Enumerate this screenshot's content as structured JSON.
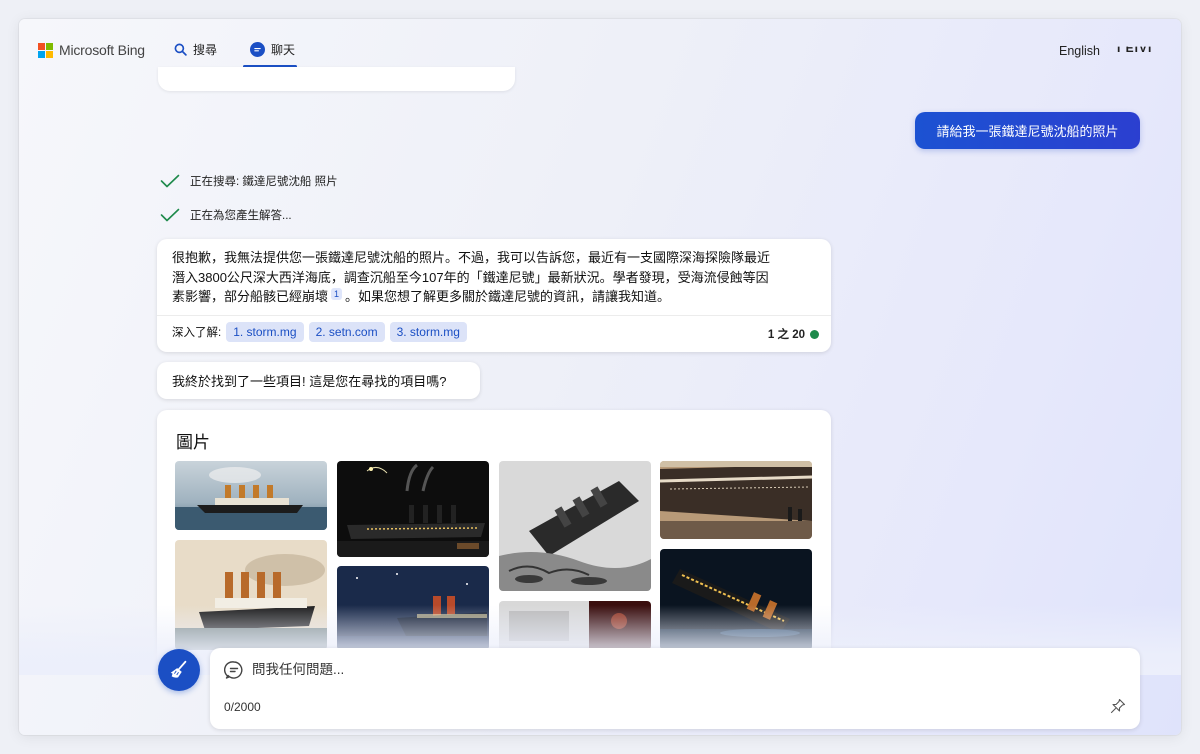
{
  "header": {
    "brand": "Microsoft Bing",
    "nav": [
      {
        "label": "搜尋",
        "icon": "search-icon"
      },
      {
        "label": "聊天",
        "icon": "chat-icon"
      }
    ],
    "language": "English",
    "cut_text": "I EIVI"
  },
  "conversation": {
    "user_message": "請給我一張鐵達尼號沈船的照片",
    "status_searching": "正在搜尋: 鐵達尼號沈船 照片",
    "status_generating": "正在為您產生解答...",
    "answer": {
      "line1": "很抱歉，我無法提供您一張鐵達尼號沈船的照片。不過，我可以告訴您，最近有一支國際深海探險隊最近",
      "line2": "潛入3800公尺深大西洋海底，調查沉船至今107年的「鐵達尼號」最新狀況。學者發現，受海流侵蝕等因",
      "line3_a": "素影響，部分船骸已經崩壞",
      "citation": "1",
      "line3_b": "。如果您想了解更多關於鐵達尼號的資訊，請讓我知道。"
    },
    "learn_more_label": "深入了解:",
    "learn_more_links": [
      "1. storm.mg",
      "2. setn.com",
      "3. storm.mg"
    ],
    "counter": "1 之 20",
    "bot_followup": "我終於找到了一些項目! 這是您在尋找的項目嗎?",
    "images_title": "圖片"
  },
  "input": {
    "placeholder": "問我任何問題...",
    "char_count": "0/2000"
  },
  "colors": {
    "accent": "#1b4fc4",
    "chip_bg": "#dce3f8",
    "success": "#1e8a4b"
  }
}
